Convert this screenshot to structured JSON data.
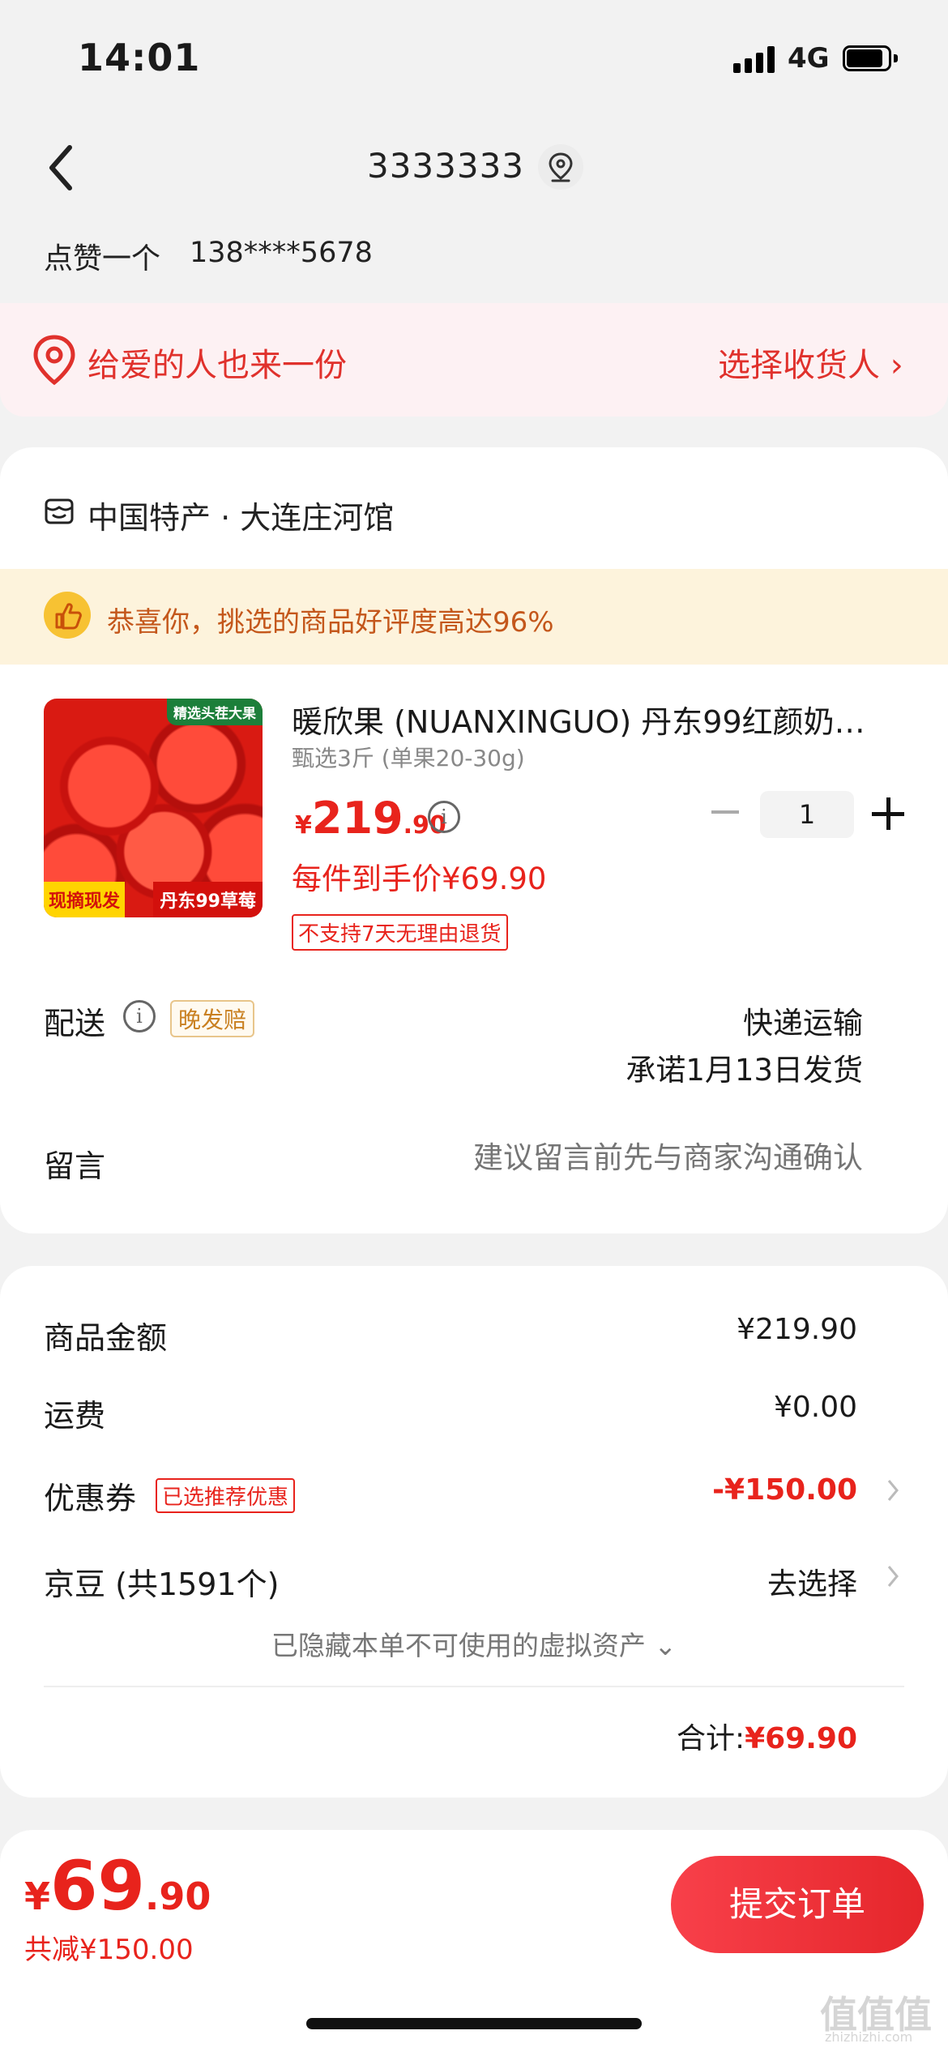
{
  "status_bar": {
    "time": "14:01",
    "network": "4G"
  },
  "nav": {
    "address_title": "3333333"
  },
  "contact": {
    "name": "点赞一个",
    "phone": "138****5678"
  },
  "gift_banner": {
    "text": "给爱的人也来一份",
    "action": "选择收货人 ›"
  },
  "shop": {
    "name": "中国特产 · 大连庄河馆"
  },
  "praise_banner": {
    "text": "恭喜你，挑选的商品好评度高达96%"
  },
  "product": {
    "image_badges": {
      "top": "精选头茬大果",
      "left": "现摘现发",
      "right": "丹东99草莓"
    },
    "title": "暖欣果 (NUANXINGUO) 丹东99红颜奶…",
    "spec": "甄选3斤 (单果20-30g)",
    "price": {
      "currency": "¥",
      "integer": "219",
      "decimal": ".90"
    },
    "info_icon": "i",
    "per_item_price": "每件到手价¥69.90",
    "return_policy": "不支持7天无理由退货",
    "quantity": "1"
  },
  "delivery": {
    "label": "配送",
    "info_icon": "i",
    "tag": "晚发赔",
    "method": "快递运输",
    "promise": "承诺1月13日发货"
  },
  "remark": {
    "label": "留言",
    "placeholder": "建议留言前先与商家沟通确认"
  },
  "summary": {
    "goods_amount": {
      "label": "商品金额",
      "value": "¥219.90"
    },
    "shipping": {
      "label": "运费",
      "value": "¥0.00"
    },
    "coupon": {
      "label": "优惠券",
      "tag": "已选推荐优惠",
      "value": "-¥150.00"
    },
    "jd_beans": {
      "label": "京豆 (共1591个)",
      "value": "去选择"
    },
    "hidden_assets": "已隐藏本单不可使用的虚拟资产 ⌄",
    "total": {
      "label": "合计:",
      "value": "¥69.90"
    }
  },
  "bottom_bar": {
    "price": {
      "currency": "¥",
      "integer": "69",
      "decimal": ".90"
    },
    "savings": "共减¥150.00",
    "submit_label": "提交订单"
  },
  "watermark": {
    "main": "值值值",
    "sub": "zhizhizhi.com"
  },
  "colors": {
    "accent": "#e8231c",
    "gift_bg": "#fdf1f3",
    "praise_bg": "#fdf3dc"
  }
}
